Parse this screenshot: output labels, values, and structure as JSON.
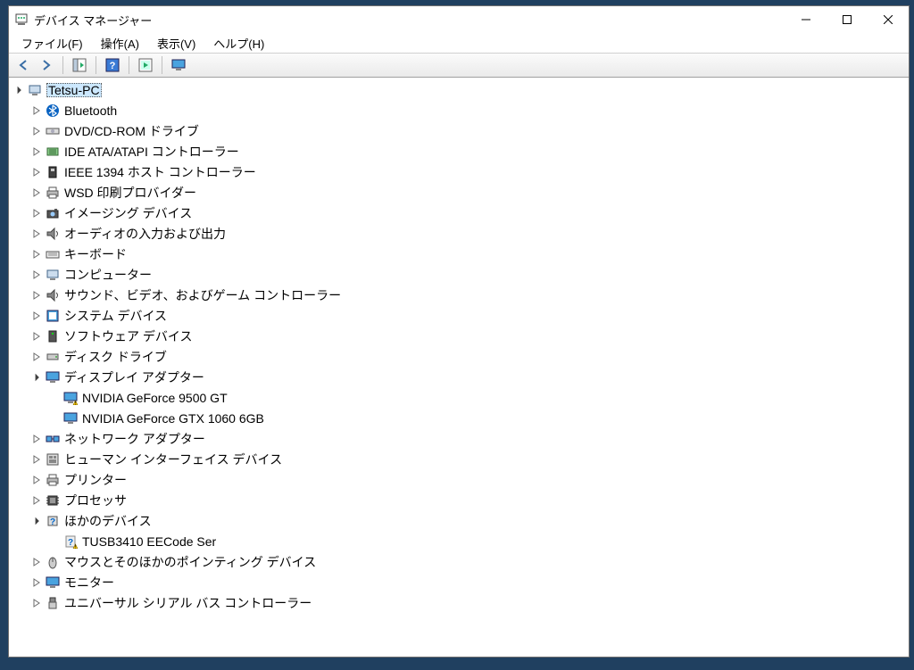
{
  "window": {
    "title": "デバイス マネージャー"
  },
  "menu": {
    "file": "ファイル(F)",
    "action": "操作(A)",
    "view": "表示(V)",
    "help": "ヘルプ(H)"
  },
  "toolbar_icons": {
    "back": "back-arrow-icon",
    "forward": "forward-arrow-icon",
    "show_tree": "show-tree-icon",
    "help": "help-icon",
    "scan": "scan-hardware-icon",
    "monitor": "monitor-icon"
  },
  "tree": {
    "root": {
      "label": "Tetsu-PC",
      "icon": "computer-icon",
      "expanded": true,
      "selected": true
    },
    "items": [
      {
        "label": "Bluetooth",
        "icon": "bluetooth-icon"
      },
      {
        "label": "DVD/CD-ROM ドライブ",
        "icon": "optical-drive-icon"
      },
      {
        "label": "IDE ATA/ATAPI コントローラー",
        "icon": "ide-controller-icon"
      },
      {
        "label": "IEEE 1394 ホスト コントローラー",
        "icon": "firewire-icon"
      },
      {
        "label": "WSD 印刷プロバイダー",
        "icon": "printer-provider-icon"
      },
      {
        "label": "イメージング デバイス",
        "icon": "imaging-device-icon"
      },
      {
        "label": "オーディオの入力および出力",
        "icon": "audio-io-icon"
      },
      {
        "label": "キーボード",
        "icon": "keyboard-icon"
      },
      {
        "label": "コンピューター",
        "icon": "computer-icon"
      },
      {
        "label": "サウンド、ビデオ、およびゲーム コントローラー",
        "icon": "sound-video-icon"
      },
      {
        "label": "システム デバイス",
        "icon": "system-device-icon"
      },
      {
        "label": "ソフトウェア デバイス",
        "icon": "software-device-icon"
      },
      {
        "label": "ディスク ドライブ",
        "icon": "disk-drive-icon"
      },
      {
        "label": "ディスプレイ アダプター",
        "icon": "display-adapter-icon",
        "expanded": true,
        "children": [
          {
            "label": "NVIDIA GeForce 9500 GT",
            "icon": "display-adapter-icon",
            "warning": true
          },
          {
            "label": "NVIDIA GeForce GTX 1060 6GB",
            "icon": "display-adapter-icon"
          }
        ]
      },
      {
        "label": "ネットワーク アダプター",
        "icon": "network-adapter-icon"
      },
      {
        "label": "ヒューマン インターフェイス デバイス",
        "icon": "hid-icon"
      },
      {
        "label": "プリンター",
        "icon": "printer-icon"
      },
      {
        "label": "プロセッサ",
        "icon": "processor-icon"
      },
      {
        "label": "ほかのデバイス",
        "icon": "other-device-icon",
        "expanded": true,
        "children": [
          {
            "label": "TUSB3410 EECode Ser",
            "icon": "unknown-device-icon",
            "warning": true
          }
        ]
      },
      {
        "label": "マウスとそのほかのポインティング デバイス",
        "icon": "mouse-icon"
      },
      {
        "label": "モニター",
        "icon": "monitor-device-icon"
      },
      {
        "label": "ユニバーサル シリアル バス コントローラー",
        "icon": "usb-controller-icon"
      }
    ]
  }
}
